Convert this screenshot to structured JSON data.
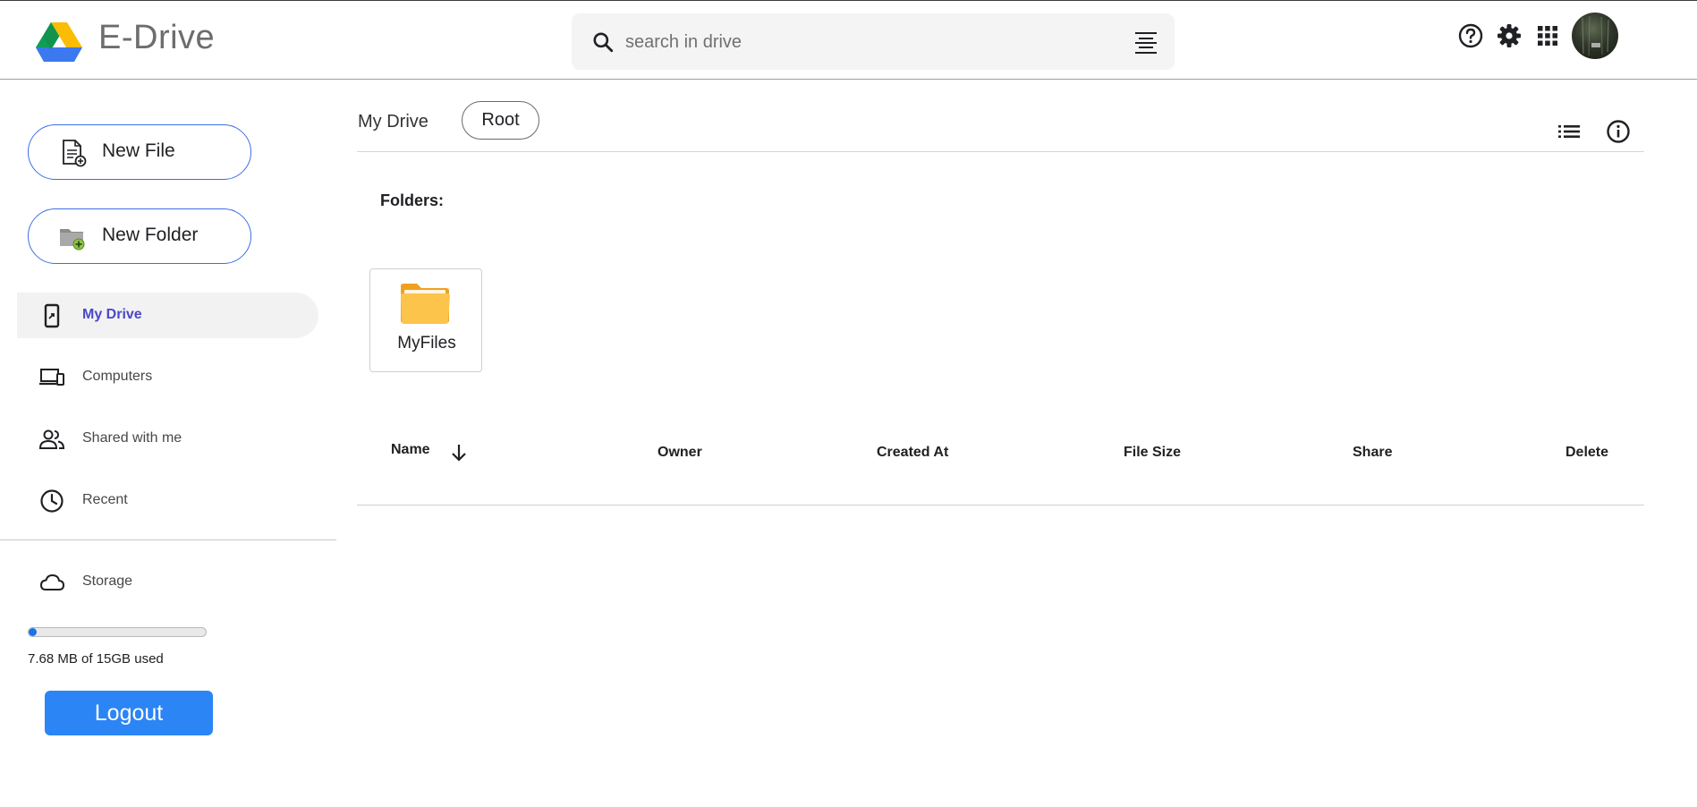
{
  "header": {
    "app_title": "E-Drive",
    "search_placeholder": "search in drive",
    "icons": [
      "drive-logo-icon",
      "search-icon",
      "filter-icon",
      "help-icon",
      "gear-icon",
      "apps-grid-icon"
    ]
  },
  "sidebar": {
    "new_file_label": "New File",
    "new_folder_label": "New Folder",
    "nav": [
      {
        "label": "My Drive",
        "icon": "phone-drive-icon",
        "active": true
      },
      {
        "label": "Computers",
        "icon": "computers-icon",
        "active": false
      },
      {
        "label": "Shared with me",
        "icon": "people-icon",
        "active": false
      },
      {
        "label": "Recent",
        "icon": "clock-icon",
        "active": false
      }
    ],
    "storage_label": "Storage",
    "storage_used_text": "7.68 MB of 15GB used",
    "storage_fraction": 0.0005,
    "logout_label": "Logout"
  },
  "main": {
    "breadcrumb": {
      "current": "My Drive",
      "pill": "Root"
    },
    "folders_heading": "Folders:",
    "folders": [
      {
        "name": "MyFiles",
        "icon": "folder-icon"
      }
    ],
    "table_headers": {
      "name": "Name",
      "owner": "Owner",
      "created_at": "Created At",
      "file_size": "File Size",
      "share": "Share",
      "delete": "Delete"
    }
  },
  "colors": {
    "accent_blue": "#2b85f5",
    "active_nav_text": "#4b48c9",
    "pill_border": "#3d6ee6",
    "folder_yellow": "#fbbf3c"
  }
}
